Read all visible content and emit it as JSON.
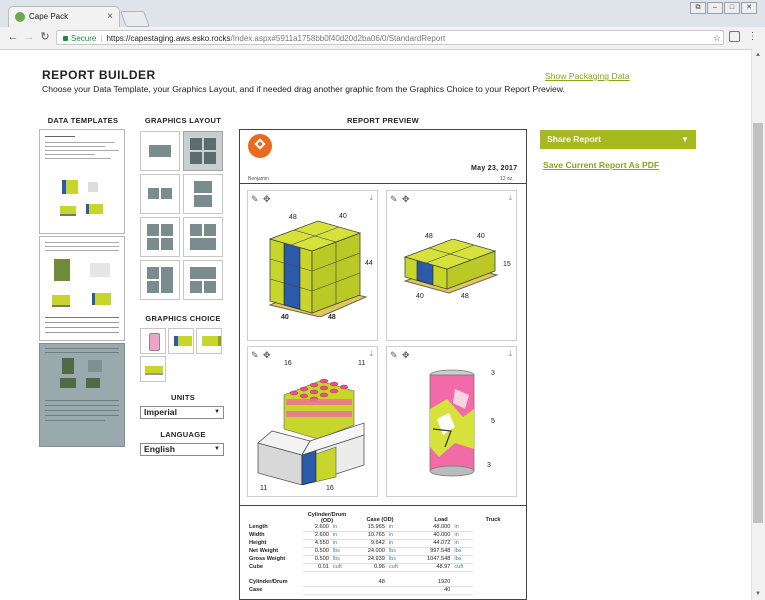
{
  "browser": {
    "tab_title": "Cape Pack",
    "tab_close": "×",
    "secure_label": "Secure",
    "url_host": "https://capestaging.aws.esko.rocks",
    "url_path": "/Index.aspx#5911a1758bb0f40d20d2ba06/0/StandardReport",
    "win_buttons": [
      "⧉",
      "–",
      "□",
      "✕"
    ]
  },
  "page": {
    "title": "REPORT BUILDER",
    "subtitle": "Choose your Data Template, your Graphics Layout, and if needed drag another graphic from the Graphics Choice to your Report Preview.",
    "show_packaging_link": "Show Packaging Data"
  },
  "columns": {
    "data_templates": "DATA TEMPLATES",
    "graphics_layout": "GRAPHICS LAYOUT",
    "report_preview": "REPORT PREVIEW"
  },
  "graphics_choice": {
    "label": "GRAPHICS CHOICE"
  },
  "units": {
    "label": "UNITS",
    "value": "Imperial"
  },
  "language": {
    "label": "LANGUAGE",
    "value": "English"
  },
  "preview": {
    "date": "May 23, 2017",
    "user": "Benjamin",
    "size": "12 oz.",
    "panel1": {
      "d1": "48",
      "d2": "40",
      "d3": "44",
      "d4": "40",
      "d5": "48"
    },
    "panel2": {
      "d1": "48",
      "d2": "40",
      "d3": "15",
      "d4": "40",
      "d5": "48"
    },
    "panel3": {
      "d1": "16",
      "d2": "11",
      "d3": "11",
      "d4": "16"
    },
    "panel4": {
      "d1": "3",
      "d2": "5",
      "d3": "3"
    }
  },
  "table": {
    "headers": [
      "",
      "Cylinder/Drum (OD)",
      "Case (OD)",
      "Load",
      "Truck"
    ],
    "rows": [
      {
        "label": "Length",
        "c1": "2.600",
        "u1": "in",
        "c2": "15.965",
        "u2": "in",
        "c3": "48.000",
        "u3": "in"
      },
      {
        "label": "Width",
        "c1": "2.600",
        "u1": "in",
        "c2": "10.765",
        "u2": "in",
        "c3": "40.000",
        "u3": "in"
      },
      {
        "label": "Height",
        "c1": "4.550",
        "u1": "in",
        "c2": "9.642",
        "u2": "in",
        "c3": "44.072",
        "u3": "in"
      },
      {
        "label": "Net Weight",
        "c1": "0.500",
        "u1": "lbs",
        "c2": "24.000",
        "u2": "lbs",
        "c3": "997.548",
        "u3": "lbs"
      },
      {
        "label": "Gross Weight",
        "c1": "0.500",
        "u1": "lbs",
        "c2": "24.939",
        "u2": "lbs",
        "c3": "1047.548",
        "u3": "lbs"
      },
      {
        "label": "Cube",
        "c1": "0.01",
        "u1": "cuft",
        "c2": "0.96",
        "u2": "cuft",
        "c3": "48.97",
        "u3": "cuft"
      }
    ],
    "count_rows": [
      {
        "label": "Cylinder/Drum",
        "c2": "48",
        "c3": "1920"
      },
      {
        "label": "Case",
        "c2": "",
        "c3": "40"
      }
    ]
  },
  "sidebar": {
    "share_label": "Share Report",
    "save_pdf_label": "Save Current Report As PDF"
  },
  "colors": {
    "accent": "#a6b91e",
    "link": "#8aa318",
    "case_yellow": "#c8d52a",
    "case_blue": "#2b5aa8"
  }
}
